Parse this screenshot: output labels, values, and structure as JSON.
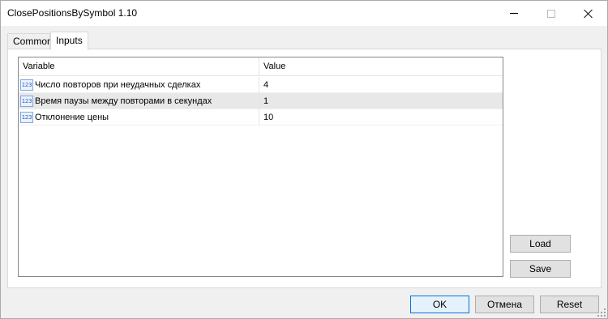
{
  "window": {
    "title": "ClosePositionsBySymbol 1.10"
  },
  "tabs": [
    {
      "label": "Common"
    },
    {
      "label": "Inputs"
    }
  ],
  "grid": {
    "columns": [
      "Variable",
      "Value"
    ],
    "rows": [
      {
        "icon": "numeric-123-icon",
        "icon_text": "123",
        "variable": "Число повторов при неудачных сделках",
        "value": "4"
      },
      {
        "icon": "numeric-123-icon",
        "icon_text": "123",
        "variable": "Время паузы между повторами в секундах",
        "value": "1"
      },
      {
        "icon": "numeric-123-icon",
        "icon_text": "123",
        "variable": "Отклонение цены",
        "value": "10"
      }
    ]
  },
  "side_buttons": {
    "load": "Load",
    "save": "Save"
  },
  "footer": {
    "ok": "OK",
    "cancel": "Отмена",
    "reset": "Reset"
  },
  "colors": {
    "selected_row": "#e8e8e8",
    "ok_border": "#0078d7",
    "icon_blue": "#2a64c5"
  }
}
